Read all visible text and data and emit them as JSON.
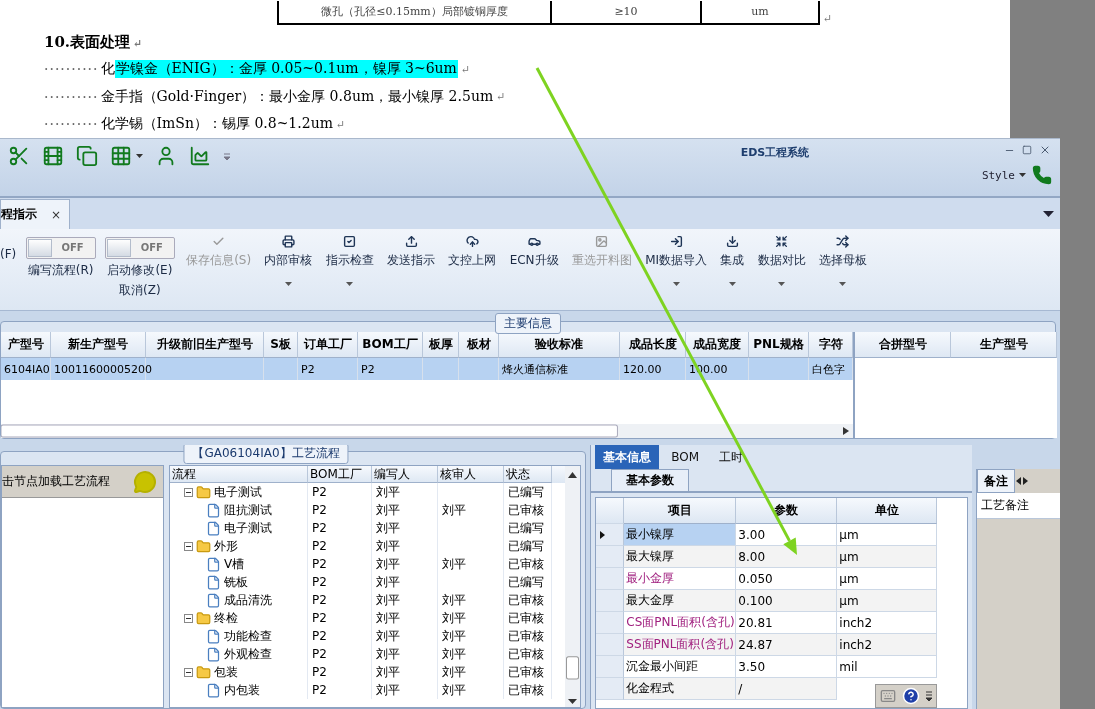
{
  "document": {
    "table_row": [
      "微孔（孔径≤0.15mm）局部镀铜厚度",
      "≥10",
      "um"
    ],
    "table_mark": "↵",
    "heading": "10.表面处理",
    "heading_mark": "↵",
    "lines": [
      {
        "leader": "··········",
        "text": "化",
        "highlight": "学镍金（ENIG）：金厚 0.05~0.1um，镍厚 3~6um",
        "tail": "↵"
      },
      {
        "leader": "··········",
        "text": "金手指（Gold·Finger）：最小金厚 0.8um，最小镍厚 2.5um",
        "tail": "↵"
      },
      {
        "leader": "··········",
        "text": "化学锡（ImSn）：锡厚 0.8~1.2um",
        "tail": "↵"
      }
    ]
  },
  "app": {
    "title": "EDS工程系统",
    "style_menu": "Style",
    "tabs": [
      {
        "label": "程指示",
        "close": "×",
        "selected": true
      }
    ],
    "ribbon": [
      {
        "kind": "label",
        "labels": [
          "(F)"
        ]
      },
      {
        "kind": "toggle",
        "state": "OFF",
        "on": false,
        "labels": [
          "编写流程(R)"
        ]
      },
      {
        "kind": "toggle",
        "state": "OFF",
        "on": false,
        "labels": [
          "启动修改(E)",
          "取消(Z)"
        ]
      },
      {
        "kind": "button",
        "labels": [
          "保存信息(S)"
        ],
        "disabled": true,
        "dropdown": false
      },
      {
        "kind": "button",
        "labels": [
          "内部审核"
        ],
        "disabled": false,
        "dropdown": true
      },
      {
        "kind": "button",
        "labels": [
          "指示检查"
        ],
        "disabled": false,
        "dropdown": true
      },
      {
        "kind": "button",
        "labels": [
          "发送指示"
        ],
        "disabled": false,
        "dropdown": false
      },
      {
        "kind": "button",
        "labels": [
          "文控上网"
        ],
        "disabled": false,
        "dropdown": false
      },
      {
        "kind": "button",
        "labels": [
          "ECN升级"
        ],
        "disabled": false,
        "dropdown": false
      },
      {
        "kind": "button",
        "labels": [
          "重选开料图"
        ],
        "disabled": true,
        "dropdown": false
      },
      {
        "kind": "button",
        "labels": [
          "MI数据导入"
        ],
        "disabled": false,
        "dropdown": true
      },
      {
        "kind": "button",
        "labels": [
          "集成"
        ],
        "disabled": false,
        "dropdown": true
      },
      {
        "kind": "button",
        "labels": [
          "数据对比"
        ],
        "disabled": false,
        "dropdown": true
      },
      {
        "kind": "button",
        "labels": [
          "选择母板"
        ],
        "disabled": false,
        "dropdown": true
      }
    ],
    "main_info": {
      "title": "主要信息",
      "columns": [
        "产型号",
        "新生产型号",
        "升级前旧生产型号",
        "S板",
        "订单工厂",
        "BOM工厂",
        "板厚",
        "板材",
        "验收标准",
        "成品长度",
        "成品宽度",
        "PNL规格",
        "字符"
      ],
      "rows": [
        {
          "selected": true,
          "cells": [
            "6104IA0",
            "10011600005200",
            null,
            null,
            "P2",
            "P2",
            null,
            null,
            "烽火通信标准",
            "120.00",
            "100.00",
            null,
            "白色字"
          ]
        }
      ],
      "side_columns": [
        "合拼型号",
        "生产型号"
      ]
    },
    "flow": {
      "title": "【GA06104IA0】工艺流程",
      "hint": "击节点加载工艺流程",
      "columns": [
        "流程",
        "BOM工厂",
        "编写人",
        "核审人",
        "状态"
      ],
      "tree": [
        {
          "name": "电子测试",
          "factory": "P2",
          "writer": "刘平",
          "status": "已编写",
          "expanded": true,
          "children": [
            {
              "name": "阻抗测试",
              "factory": "P2",
              "writer": "刘平",
              "reviewer": "刘平",
              "status": "已审核"
            },
            {
              "name": "电子测试",
              "factory": "P2",
              "writer": "刘平",
              "status": "已编写"
            }
          ]
        },
        {
          "name": "外形",
          "factory": "P2",
          "writer": "刘平",
          "status": "已编写",
          "expanded": true,
          "children": [
            {
              "name": "V槽",
              "factory": "P2",
              "writer": "刘平",
              "reviewer": "刘平",
              "status": "已审核"
            },
            {
              "name": "铣板",
              "factory": "P2",
              "writer": "刘平",
              "status": "已编写"
            },
            {
              "name": "成品清洗",
              "factory": "P2",
              "writer": "刘平",
              "reviewer": "刘平",
              "status": "已审核"
            }
          ]
        },
        {
          "name": "终检",
          "factory": "P2",
          "writer": "刘平",
          "reviewer": "刘平",
          "status": "已审核",
          "expanded": true,
          "children": [
            {
              "name": "功能检查",
              "factory": "P2",
              "writer": "刘平",
              "reviewer": "刘平",
              "status": "已审核"
            },
            {
              "name": "外观检查",
              "factory": "P2",
              "writer": "刘平",
              "reviewer": "刘平",
              "status": "已审核"
            }
          ]
        },
        {
          "name": "包装",
          "factory": "P2",
          "writer": "刘平",
          "reviewer": "刘平",
          "status": "已审核",
          "expanded": true,
          "children": [
            {
              "name": "内包装",
              "factory": "P2",
              "writer": "刘平",
              "reviewer": "刘平",
              "status": "已审核"
            }
          ]
        }
      ]
    },
    "detail": {
      "tabs": [
        {
          "label": "基本信息",
          "selected": true
        },
        {
          "label": "BOM",
          "selected": false
        },
        {
          "label": "工时",
          "selected": false
        }
      ],
      "subtab": "基本参数",
      "columns": [
        "项目",
        "参数",
        "单位"
      ],
      "rows": [
        {
          "item": "最小镍厚",
          "value": "3.00",
          "unit": "μm",
          "highlighted": false,
          "selected": true
        },
        {
          "item": "最大镍厚",
          "value": "8.00",
          "unit": "μm",
          "highlighted": false,
          "selected": false
        },
        {
          "item": "最小金厚",
          "value": "0.050",
          "unit": "μm",
          "highlighted": true,
          "selected": false
        },
        {
          "item": "最大金厚",
          "value": "0.100",
          "unit": "μm",
          "highlighted": false,
          "selected": false
        },
        {
          "item": "CS面PNL面积(含孔)",
          "value": "20.81",
          "unit": "inch2",
          "highlighted": true,
          "selected": false
        },
        {
          "item": "SS面PNL面积(含孔)",
          "value": "24.87",
          "unit": "inch2",
          "highlighted": true,
          "selected": false
        },
        {
          "item": "沉金最小间距",
          "value": "3.50",
          "unit": "mil",
          "highlighted": false,
          "selected": false
        },
        {
          "item": "化金程式",
          "value": "/",
          "highlighted": false,
          "selected": false
        }
      ]
    },
    "notes": {
      "tab": "备注",
      "row": "工艺备注"
    }
  }
}
